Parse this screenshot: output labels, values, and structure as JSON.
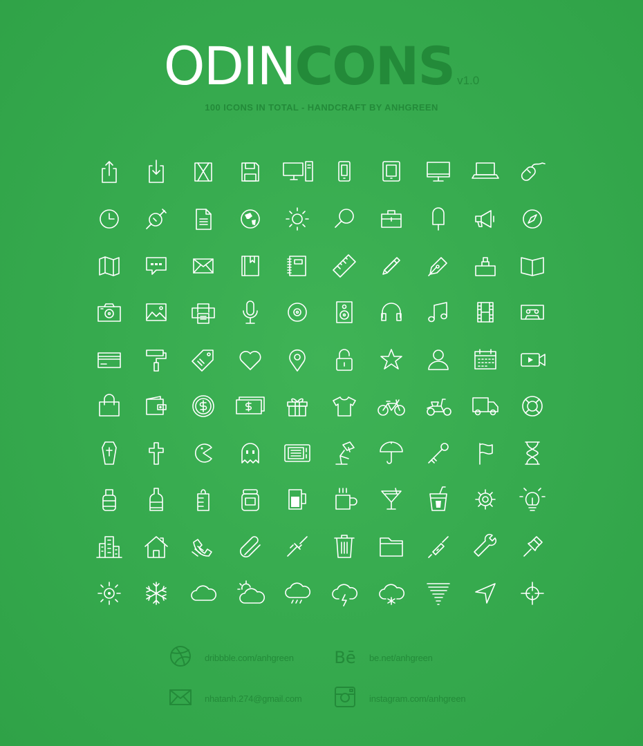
{
  "header": {
    "title_light": "ODIN",
    "title_bold": "CONS",
    "version": "v1.0",
    "subtitle": "100 ICONS IN TOTAL - HANDCRAFT BY ANHGREEN"
  },
  "colors": {
    "background": "#37ab4f",
    "icon": "#ffffff",
    "accent": "#238a39"
  },
  "icons": [
    [
      "upload-icon",
      "download-icon",
      "hourglass-box-icon",
      "floppy-disk-icon",
      "desktop-tower-icon",
      "phone-icon",
      "tablet-icon",
      "monitor-icon",
      "laptop-icon",
      "mouse-icon"
    ],
    [
      "clock-icon",
      "gps-satellite-icon",
      "document-icon",
      "globe-icon",
      "sun-icon",
      "search-icon",
      "briefcase-icon",
      "popsicle-icon",
      "megaphone-icon",
      "compass-icon"
    ],
    [
      "map-icon",
      "chat-bubble-icon",
      "envelope-icon",
      "bookmark-book-icon",
      "notebook-icon",
      "ruler-icon",
      "pencil-icon",
      "pen-nib-icon",
      "stamp-icon",
      "open-book-icon"
    ],
    [
      "camera-icon",
      "image-icon",
      "printer-icon",
      "microphone-icon",
      "disc-icon",
      "speaker-icon",
      "headphones-icon",
      "music-note-icon",
      "film-icon",
      "cassette-icon"
    ],
    [
      "credit-card-icon",
      "paint-roller-icon",
      "tag-icon",
      "heart-icon",
      "map-pin-icon",
      "padlock-icon",
      "star-icon",
      "user-icon",
      "calendar-icon",
      "video-camera-icon"
    ],
    [
      "shopping-bag-icon",
      "wallet-icon",
      "dollar-coin-icon",
      "banknote-icon",
      "gift-icon",
      "t-shirt-icon",
      "bicycle-icon",
      "scooter-icon",
      "truck-icon",
      "lifebuoy-icon"
    ],
    [
      "coffin-icon",
      "cross-icon",
      "pacman-icon",
      "ghost-icon",
      "microwave-icon",
      "desk-lamp-icon",
      "umbrella-icon",
      "key-icon",
      "flag-icon",
      "hourglass-icon"
    ],
    [
      "spray-bottle-icon",
      "wine-bottle-icon",
      "baby-bottle-icon",
      "jar-icon",
      "beer-mug-icon",
      "coffee-mug-icon",
      "cocktail-icon",
      "soda-cup-icon",
      "settings-gear-icon",
      "lightbulb-icon"
    ],
    [
      "city-buildings-icon",
      "house-icon",
      "telephone-icon",
      "paperclip-icon",
      "link-icon",
      "trash-can-icon",
      "folder-icon",
      "screwdriver-icon",
      "wrench-icon",
      "push-pin-icon"
    ],
    [
      "sunny-icon",
      "snowflake-icon",
      "cloud-icon",
      "partly-cloudy-icon",
      "rain-cloud-icon",
      "thunder-cloud-icon",
      "snow-cloud-icon",
      "tornado-icon",
      "navigation-arrow-icon",
      "crosshair-icon"
    ]
  ],
  "footer": {
    "dribbble": {
      "icon": "dribbble-icon",
      "text": "dribbble.com/anhgreen"
    },
    "behance": {
      "icon": "behance-icon",
      "glyph": "Bē",
      "text": "be.net/anhgreen"
    },
    "email": {
      "icon": "envelope-icon",
      "text": "nhatanh.274@gmail.com"
    },
    "instagram": {
      "icon": "instagram-icon",
      "text": "instagram.com/anhgreen"
    }
  }
}
